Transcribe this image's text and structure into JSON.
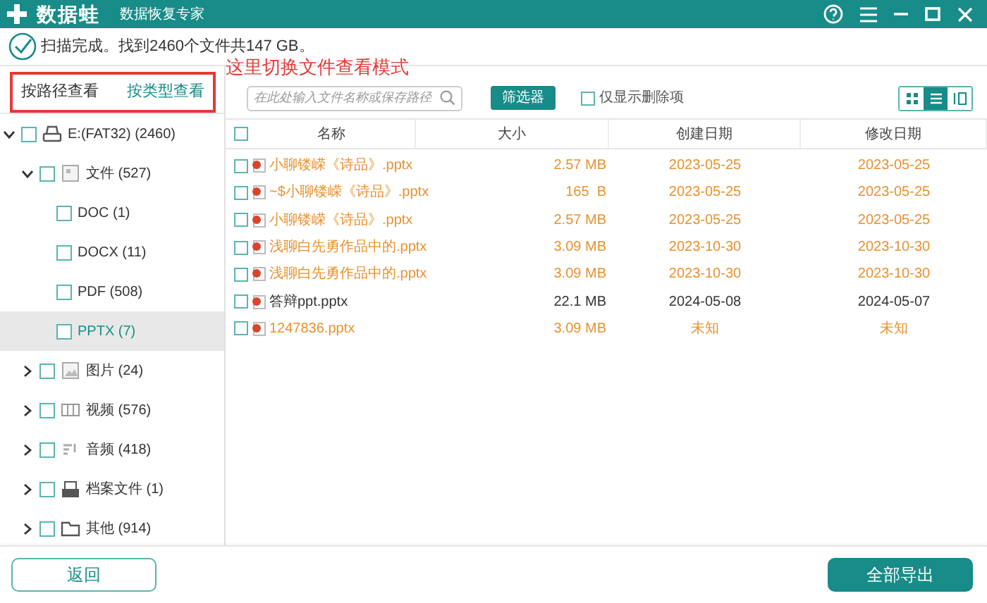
{
  "window": {
    "app_name": "数据蛙",
    "subtitle": "数据恢复专家"
  },
  "status": "扫描完成。找到2460个文件共147 GB。",
  "annotation": "这里切换文件查看模式",
  "view_modes": [
    {
      "label": "按路径查看",
      "selected": false
    },
    {
      "label": "按类型查看",
      "selected": true
    }
  ],
  "search": {
    "placeholder": "在此处输入文件名称或保存路径"
  },
  "filter_button": "筛选器",
  "deleted_only": {
    "label": "仅显示删除项",
    "checked": false
  },
  "layouts": [
    {
      "kind": "grid",
      "selected": false
    },
    {
      "kind": "list",
      "selected": true
    },
    {
      "kind": "columns",
      "selected": false
    }
  ],
  "tree": [
    {
      "label": "E:(FAT32) (2460)",
      "kind": "drive",
      "expanded": true,
      "checked": false,
      "selected": false,
      "children": [
        {
          "label": "文件 (527)",
          "kind": "document",
          "expanded": true,
          "checked": false,
          "selected": false,
          "children": [
            {
              "label": "DOC (1)",
              "checked": false,
              "selected": false
            },
            {
              "label": "DOCX (11)",
              "checked": false,
              "selected": false
            },
            {
              "label": "PDF (508)",
              "checked": false,
              "selected": false
            },
            {
              "label": "PPTX (7)",
              "checked": false,
              "selected": true
            }
          ]
        },
        {
          "label": "图片 (24)",
          "kind": "image",
          "expanded": false,
          "checked": false,
          "selected": false
        },
        {
          "label": "视频 (576)",
          "kind": "video",
          "expanded": false,
          "checked": false,
          "selected": false
        },
        {
          "label": "音频 (418)",
          "kind": "audio",
          "expanded": false,
          "checked": false,
          "selected": false
        },
        {
          "label": "档案文件 (1)",
          "kind": "archive",
          "expanded": false,
          "checked": false,
          "selected": false
        },
        {
          "label": "其他 (914)",
          "kind": "folder",
          "expanded": false,
          "checked": false,
          "selected": false
        }
      ]
    }
  ],
  "table": {
    "all_checked": false,
    "columns": [
      "名称",
      "大小",
      "创建日期",
      "修改日期"
    ],
    "rows": [
      {
        "name": "小聊镂嵘《诗品》.pptx",
        "size": "2.57 MB",
        "created": "2023-05-25",
        "modified": "2023-05-25",
        "deleted": true,
        "checked": false
      },
      {
        "name": "~$小聊镂嵘《诗品》.pptx",
        "size": "165  B",
        "created": "2023-05-25",
        "modified": "2023-05-25",
        "deleted": true,
        "checked": false
      },
      {
        "name": "小聊镂嵘《诗品》.pptx",
        "size": "2.57 MB",
        "created": "2023-05-25",
        "modified": "2023-05-25",
        "deleted": true,
        "checked": false
      },
      {
        "name": "浅聊白先勇作品中的.pptx",
        "size": "3.09 MB",
        "created": "2023-10-30",
        "modified": "2023-10-30",
        "deleted": true,
        "checked": false
      },
      {
        "name": "浅聊白先勇作品中的.pptx",
        "size": "3.09 MB",
        "created": "2023-10-30",
        "modified": "2023-10-30",
        "deleted": true,
        "checked": false
      },
      {
        "name": "答辩ppt.pptx",
        "size": "22.1 MB",
        "created": "2024-05-08",
        "modified": "2024-05-07",
        "deleted": false,
        "checked": false
      },
      {
        "name": "1247836.pptx",
        "size": "3.09 MB",
        "created": "未知",
        "modified": "未知",
        "deleted": true,
        "checked": false
      }
    ]
  },
  "footer": {
    "back_button": "返回",
    "export_button": "全部导出"
  }
}
